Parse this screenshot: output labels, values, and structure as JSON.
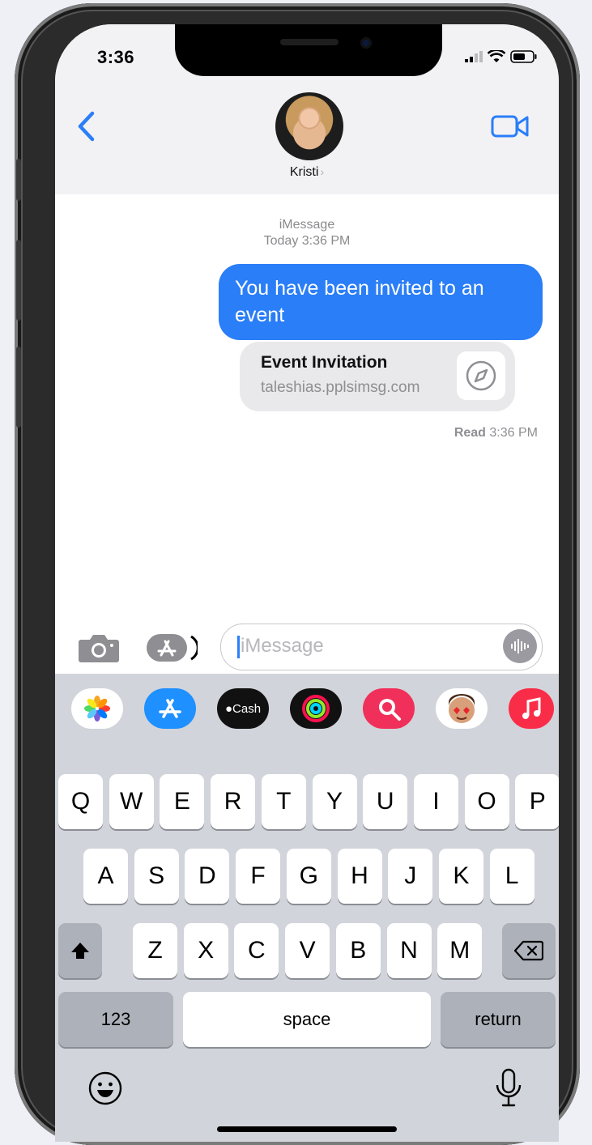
{
  "status_bar": {
    "time": "3:36"
  },
  "header": {
    "contact_name": "Kristi",
    "back_icon": "chevron-left-icon",
    "video_icon": "video-camera-icon"
  },
  "thread": {
    "service": "iMessage",
    "timestamp": "Today 3:36 PM",
    "sent_message": "You have been invited to an event",
    "link_preview": {
      "title": "Event Invitation",
      "url": "taleshias.pplsimsg.com",
      "icon": "compass-icon"
    },
    "read_receipt_label": "Read",
    "read_receipt_time": "3:36 PM"
  },
  "compose": {
    "placeholder": "iMessage"
  },
  "app_strip": {
    "apps": [
      {
        "name": "photos-app-icon",
        "label": ""
      },
      {
        "name": "app-store-icon",
        "label": ""
      },
      {
        "name": "apple-cash-icon",
        "label": "Cash"
      },
      {
        "name": "activity-icon",
        "label": ""
      },
      {
        "name": "search-images-icon",
        "label": ""
      },
      {
        "name": "memoji-icon",
        "label": ""
      },
      {
        "name": "music-icon",
        "label": ""
      }
    ]
  },
  "keyboard": {
    "row1": [
      "Q",
      "W",
      "E",
      "R",
      "T",
      "Y",
      "U",
      "I",
      "O",
      "P"
    ],
    "row2": [
      "A",
      "S",
      "D",
      "F",
      "G",
      "H",
      "J",
      "K",
      "L"
    ],
    "row3": [
      "Z",
      "X",
      "C",
      "V",
      "B",
      "N",
      "M"
    ],
    "numbers_label": "123",
    "space_label": "space",
    "return_label": "return"
  },
  "colors": {
    "accent": "#2a7ef7",
    "bubble_gray": "#e9e9eb",
    "keyboard_bg": "#d1d4da"
  }
}
